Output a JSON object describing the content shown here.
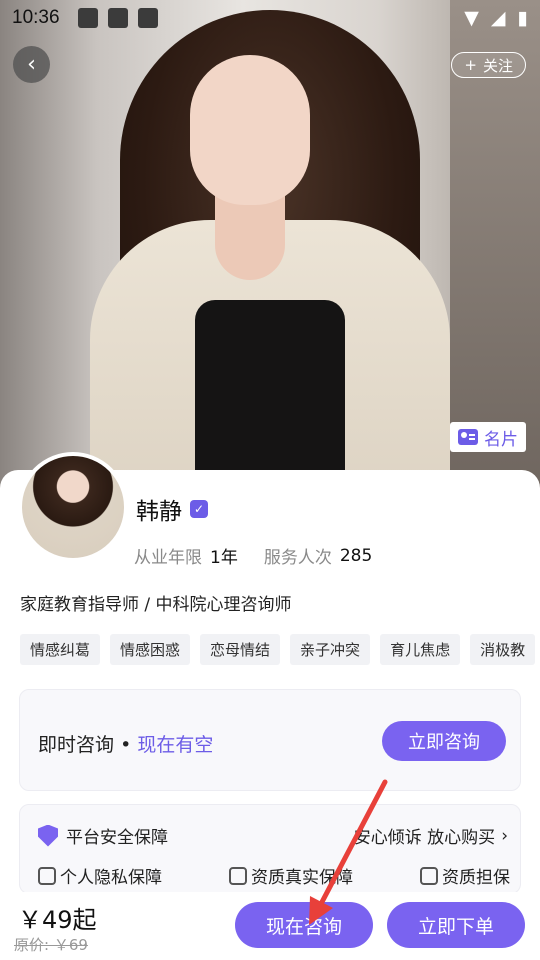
{
  "status_bar": {
    "time": "10:36"
  },
  "header": {
    "follow_label": "关注",
    "card_label": "名片"
  },
  "profile": {
    "name": "韩静",
    "years_label": "从业年限",
    "years_value": "1年",
    "served_label": "服务人次",
    "served_value": "285",
    "title": "家庭教育指导师 / 中科院心理咨询师",
    "tags": [
      "情感纠葛",
      "情感困惑",
      "恋母情结",
      "亲子冲突",
      "育儿焦虑",
      "消极教"
    ]
  },
  "consult": {
    "label": "即时咨询",
    "separator": "•",
    "status": "现在有空",
    "button": "立即咨询"
  },
  "guarantee": {
    "head": "平台安全保障",
    "right": "安心倾诉 放心购买",
    "items": [
      "个人隐私保障",
      "资质真实保障",
      "资质担保"
    ]
  },
  "bottom": {
    "price": "￥49起",
    "original_price": "原价: ￥69",
    "consult_now": "现在咨询",
    "order_now": "立即下单"
  },
  "colors": {
    "accent": "#7a63f0",
    "annotation_arrow": "#e8403a"
  }
}
